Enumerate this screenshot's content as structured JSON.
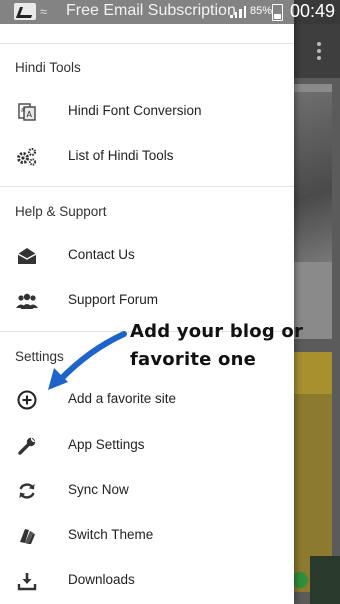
{
  "status_bar": {
    "notification_title": "Free Email Subscription",
    "battery": "85%",
    "time": "00:49"
  },
  "drawer": {
    "sections": [
      {
        "header": "Hindi Tools",
        "items": [
          {
            "label": "Hindi Font Conversion",
            "icon": "font-conversion-icon"
          },
          {
            "label": "List of Hindi Tools",
            "icon": "gears-icon"
          }
        ]
      },
      {
        "header": "Help & Support",
        "items": [
          {
            "label": "Contact Us",
            "icon": "envelope-icon"
          },
          {
            "label": "Support Forum",
            "icon": "users-icon"
          }
        ]
      },
      {
        "header": "Settings",
        "items": [
          {
            "label": "Add a favorite site",
            "icon": "add-circle-icon"
          },
          {
            "label": "App Settings",
            "icon": "wrench-icon"
          },
          {
            "label": "Sync Now",
            "icon": "sync-icon"
          },
          {
            "label": "Switch Theme",
            "icon": "theme-icon"
          },
          {
            "label": "Downloads",
            "icon": "download-icon"
          }
        ]
      }
    ]
  },
  "annotation": {
    "line1": "Add your blog  or",
    "line2": "favorite one",
    "arrow_color": "#1e64c8"
  }
}
